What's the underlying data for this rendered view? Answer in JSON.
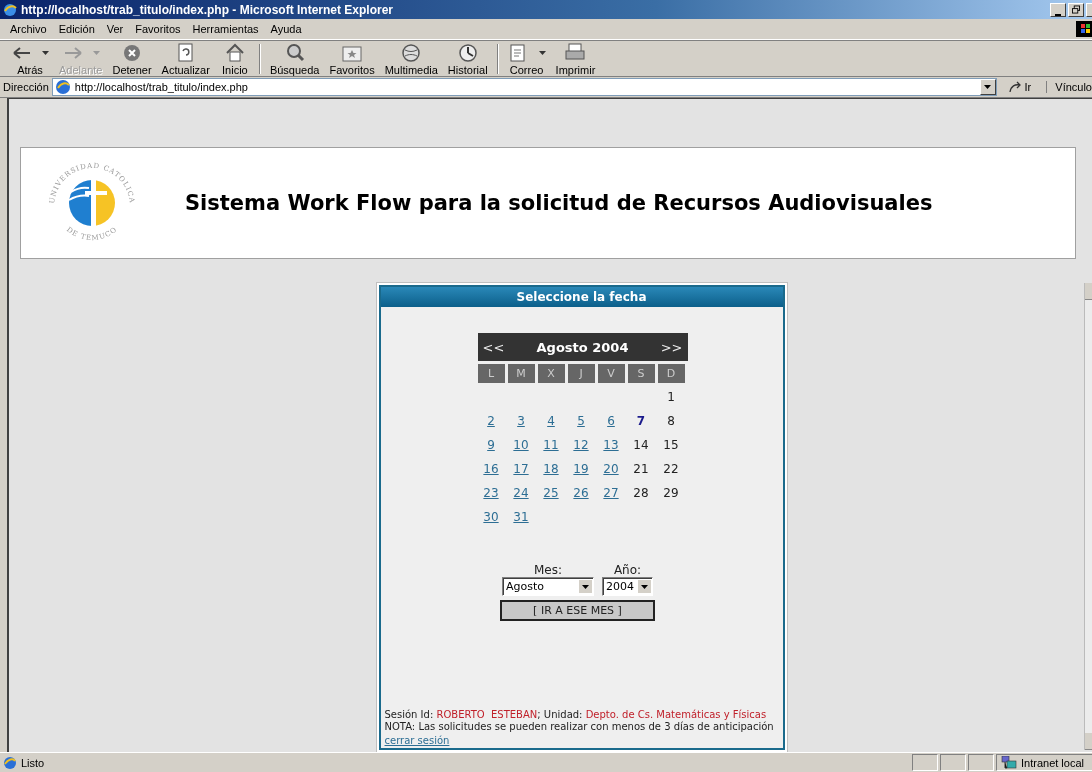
{
  "window": {
    "title": "http://localhost/trab_titulo/index.php - Microsoft Internet Explorer"
  },
  "menu": [
    "Archivo",
    "Edición",
    "Ver",
    "Favoritos",
    "Herramientas",
    "Ayuda"
  ],
  "toolbar_groups": [
    [
      {
        "kind": "back",
        "label": "Atrás",
        "disabled": false,
        "dropdown": true
      },
      {
        "kind": "forward",
        "label": "Adelante",
        "disabled": true,
        "dropdown": true
      },
      {
        "kind": "stop",
        "label": "Detener",
        "disabled": false,
        "dropdown": false
      },
      {
        "kind": "refresh",
        "label": "Actualizar",
        "disabled": false,
        "dropdown": false
      },
      {
        "kind": "home",
        "label": "Inicio",
        "disabled": false,
        "dropdown": false
      }
    ],
    [
      {
        "kind": "search",
        "label": "Búsqueda",
        "disabled": false,
        "dropdown": false
      },
      {
        "kind": "favorites",
        "label": "Favoritos",
        "disabled": false,
        "dropdown": false
      },
      {
        "kind": "media",
        "label": "Multimedia",
        "disabled": false,
        "dropdown": false
      },
      {
        "kind": "history",
        "label": "Historial",
        "disabled": false,
        "dropdown": false
      }
    ],
    [
      {
        "kind": "mail",
        "label": "Correo",
        "disabled": false,
        "dropdown": true
      },
      {
        "kind": "print",
        "label": "Imprimir",
        "disabled": false,
        "dropdown": false
      }
    ]
  ],
  "address_bar": {
    "label": "Dirección",
    "url": "http://localhost/trab_titulo/index.php",
    "go": "Ir",
    "links": "Vínculo"
  },
  "header": {
    "logo_text_top": "UNIVERSIDAD CATOLICA",
    "logo_text_bottom": "DE TEMUCO",
    "title": "Sistema Work Flow para la solicitud de Recursos Audiovisuales"
  },
  "panel": {
    "title": "Seleccione la fecha",
    "calendar": {
      "prev": "<<",
      "month": "Agosto 2004",
      "next": ">>",
      "weekdays": [
        "L",
        "M",
        "X",
        "J",
        "V",
        "S",
        "D"
      ],
      "weeks": [
        [
          {
            "day": "1",
            "kind": "plain"
          }
        ],
        [
          {
            "day": "2",
            "kind": "link"
          },
          {
            "day": "3",
            "kind": "link"
          },
          {
            "day": "4",
            "kind": "link"
          },
          {
            "day": "5",
            "kind": "link"
          },
          {
            "day": "6",
            "kind": "link"
          },
          {
            "day": "7",
            "kind": "today"
          },
          {
            "day": "8",
            "kind": "plain"
          }
        ],
        [
          {
            "day": "9",
            "kind": "link"
          },
          {
            "day": "10",
            "kind": "link"
          },
          {
            "day": "11",
            "kind": "link"
          },
          {
            "day": "12",
            "kind": "link"
          },
          {
            "day": "13",
            "kind": "link"
          },
          {
            "day": "14",
            "kind": "plain"
          },
          {
            "day": "15",
            "kind": "plain"
          }
        ],
        [
          {
            "day": "16",
            "kind": "link"
          },
          {
            "day": "17",
            "kind": "link"
          },
          {
            "day": "18",
            "kind": "link"
          },
          {
            "day": "19",
            "kind": "link"
          },
          {
            "day": "20",
            "kind": "link"
          },
          {
            "day": "21",
            "kind": "plain"
          },
          {
            "day": "22",
            "kind": "plain"
          }
        ],
        [
          {
            "day": "23",
            "kind": "link"
          },
          {
            "day": "24",
            "kind": "link"
          },
          {
            "day": "25",
            "kind": "link"
          },
          {
            "day": "26",
            "kind": "link"
          },
          {
            "day": "27",
            "kind": "link"
          },
          {
            "day": "28",
            "kind": "plain"
          },
          {
            "day": "29",
            "kind": "plain"
          }
        ],
        [
          {
            "day": "30",
            "kind": "link"
          },
          {
            "day": "31",
            "kind": "link"
          }
        ]
      ]
    },
    "month_label": "Mes:",
    "month_value": "Agosto",
    "year_label": "Año:",
    "year_value": "2004",
    "go_button": "[ IR A ESE MES ]",
    "session": {
      "id_label": "Sesión Id: ",
      "id": "ROBERTO  ESTEBAN",
      "unit_label": "; Unidad: ",
      "unit": "Depto. de Cs. Matemáticas y Físicas"
    },
    "note": "NOTA: Las solicitudes se pueden realizar con menos de 3 días de anticipación",
    "logout": "cerrar sesión"
  },
  "status_bar": {
    "text": "Listo",
    "zone": "Intranet local"
  }
}
